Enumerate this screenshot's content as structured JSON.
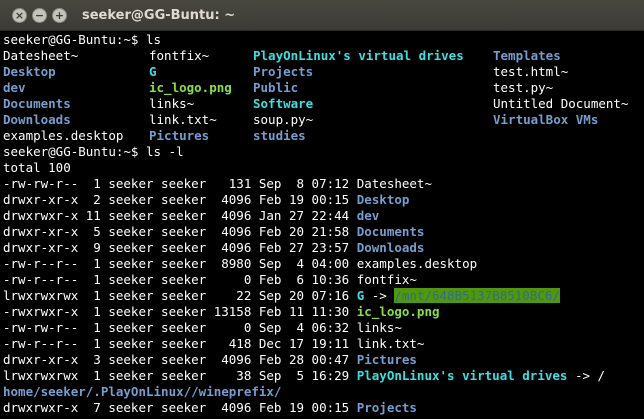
{
  "window": {
    "title": "seeker@GG-Buntu: ~",
    "buttons": {
      "close": "×",
      "minimize": "−",
      "maximize": "+"
    }
  },
  "colors": {
    "directory": "#729fcf",
    "executable": "#8ae234",
    "symlink": "#34e2e2",
    "other_writable_fg": "#3465a4",
    "other_writable_bg": "#4e9a06",
    "background": "#000000",
    "text": "#ffffff"
  },
  "terminal": {
    "prompt1": "seeker@GG-Buntu:~$ ls",
    "ls_rows": [
      [
        {
          "text": "Datesheet~",
          "kind": "file"
        },
        {
          "text": "fontfix~",
          "kind": "file"
        },
        {
          "text": "PlayOnLinux's virtual drives",
          "kind": "link"
        },
        {
          "text": "Templates",
          "kind": "dir"
        }
      ],
      [
        {
          "text": "Desktop",
          "kind": "dir"
        },
        {
          "text": "G",
          "kind": "link"
        },
        {
          "text": "Projects",
          "kind": "dir"
        },
        {
          "text": "test.html~",
          "kind": "file"
        }
      ],
      [
        {
          "text": "dev",
          "kind": "dir"
        },
        {
          "text": "ic_logo.png",
          "kind": "exe"
        },
        {
          "text": "Public",
          "kind": "dir"
        },
        {
          "text": "test.py~",
          "kind": "file"
        }
      ],
      [
        {
          "text": "Documents",
          "kind": "dir"
        },
        {
          "text": "links~",
          "kind": "file"
        },
        {
          "text": "Software",
          "kind": "link"
        },
        {
          "text": "Untitled Document~",
          "kind": "file"
        }
      ],
      [
        {
          "text": "Downloads",
          "kind": "dir"
        },
        {
          "text": "link.txt~",
          "kind": "file"
        },
        {
          "text": "soup.py~",
          "kind": "file"
        },
        {
          "text": "VirtualBox VMs",
          "kind": "dir"
        }
      ],
      [
        {
          "text": "examples.desktop",
          "kind": "file"
        },
        {
          "text": "Pictures",
          "kind": "dir"
        },
        {
          "text": "studies",
          "kind": "dir"
        },
        {
          "text": "",
          "kind": "file"
        }
      ]
    ],
    "prompt2": "seeker@GG-Buntu:~$ ls -l",
    "total": "total 100",
    "entries": [
      {
        "meta": "-rw-rw-r--  1 seeker seeker   131 Sep  8 07:12 ",
        "name": "Datesheet~",
        "kind": "file",
        "arrow": "",
        "target": "",
        "tkind": "file"
      },
      {
        "meta": "drwxr-xr-x  2 seeker seeker  4096 Feb 19 00:15 ",
        "name": "Desktop",
        "kind": "dir",
        "arrow": "",
        "target": "",
        "tkind": "file"
      },
      {
        "meta": "drwxrwxr-x 11 seeker seeker  4096 Jan 27 22:44 ",
        "name": "dev",
        "kind": "dir",
        "arrow": "",
        "target": "",
        "tkind": "file"
      },
      {
        "meta": "drwxr-xr-x  5 seeker seeker  4096 Feb 20 21:58 ",
        "name": "Documents",
        "kind": "dir",
        "arrow": "",
        "target": "",
        "tkind": "file"
      },
      {
        "meta": "drwxr-xr-x  9 seeker seeker  4096 Feb 27 23:57 ",
        "name": "Downloads",
        "kind": "dir",
        "arrow": "",
        "target": "",
        "tkind": "file"
      },
      {
        "meta": "-rw-r--r--  1 seeker seeker  8980 Sep  4 04:00 ",
        "name": "examples.desktop",
        "kind": "file",
        "arrow": "",
        "target": "",
        "tkind": "file"
      },
      {
        "meta": "-rw-r--r--  1 seeker seeker     0 Feb  6 10:36 ",
        "name": "fontfix~",
        "kind": "file",
        "arrow": "",
        "target": "",
        "tkind": "file"
      },
      {
        "meta": "lrwxrwxrwx  1 seeker seeker    22 Sep 20 07:16 ",
        "name": "G",
        "kind": "link",
        "arrow": " -> ",
        "target": "/mnt/648B5137B8510BC6/",
        "tkind": "ow"
      },
      {
        "meta": "-rwxrwxr-x  1 seeker seeker 13158 Feb 11 11:30 ",
        "name": "ic_logo.png",
        "kind": "exe",
        "arrow": "",
        "target": "",
        "tkind": "file"
      },
      {
        "meta": "-rw-rw-r--  1 seeker seeker     0 Sep  4 06:32 ",
        "name": "links~",
        "kind": "file",
        "arrow": "",
        "target": "",
        "tkind": "file"
      },
      {
        "meta": "-rw-r--r--  1 seeker seeker   418 Dec 17 19:11 ",
        "name": "link.txt~",
        "kind": "file",
        "arrow": "",
        "target": "",
        "tkind": "file"
      },
      {
        "meta": "drwxr-xr-x  3 seeker seeker  4096 Feb 28 00:47 ",
        "name": "Pictures",
        "kind": "dir",
        "arrow": "",
        "target": "",
        "tkind": "file"
      },
      {
        "meta": "lrwxrwxrwx  1 seeker seeker    38 Sep  5 16:29 ",
        "name": "PlayOnLinux's virtual drives",
        "kind": "link",
        "arrow": " -> /",
        "target": "",
        "tkind": "file"
      },
      {
        "meta": "",
        "name": "",
        "kind": "file",
        "arrow": "",
        "target": "home/seeker/.PlayOnLinux//wineprefix/",
        "tkind": "dir"
      },
      {
        "meta": "drwxrwxr-x  7 seeker seeker  4096 Feb 19 00:15 ",
        "name": "Projects",
        "kind": "dir",
        "arrow": "",
        "target": "",
        "tkind": "file"
      }
    ]
  }
}
